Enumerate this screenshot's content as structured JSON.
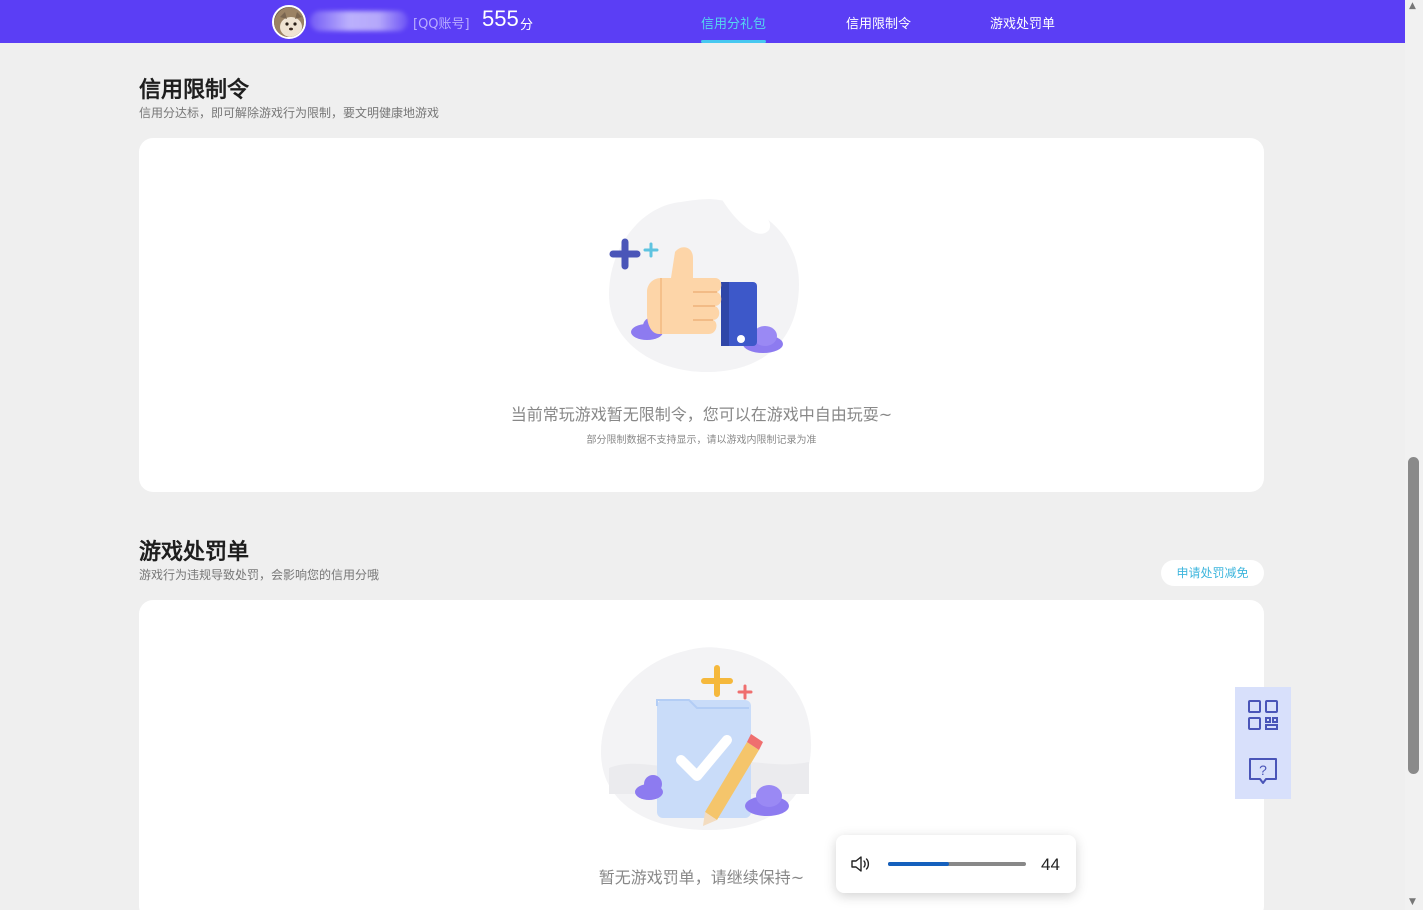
{
  "header": {
    "account_type": "[QQ账号]",
    "score": "555",
    "score_unit": "分",
    "tabs": [
      {
        "label": "信用分礼包",
        "active": true
      },
      {
        "label": "信用限制令",
        "active": false
      },
      {
        "label": "游戏处罚单",
        "active": false
      }
    ],
    "accent_color": "#5b3ef5",
    "active_tab_color": "#55d7f0"
  },
  "restriction": {
    "title": "信用限制令",
    "subtitle": "信用分达标，即可解除游戏行为限制，要文明健康地游戏",
    "empty_message": "当前常玩游戏暂无限制令，您可以在游戏中自由玩耍~",
    "empty_note": "部分限制数据不支持显示，请以游戏内限制记录为准",
    "illustration_icon": "thumbs-up-illustration"
  },
  "penalty": {
    "title": "游戏处罚单",
    "subtitle": "游戏行为违规导致处罚，会影响您的信用分哦",
    "appeal_button": "申请处罚减免",
    "empty_message": "暂无游戏罚单，请继续保持~",
    "illustration_icon": "checklist-illustration"
  },
  "floating_tools": [
    {
      "icon": "qr-code-icon"
    },
    {
      "icon": "help-chat-icon"
    }
  ],
  "volume": {
    "icon": "speaker-icon",
    "value": "44",
    "level": 0.44
  }
}
